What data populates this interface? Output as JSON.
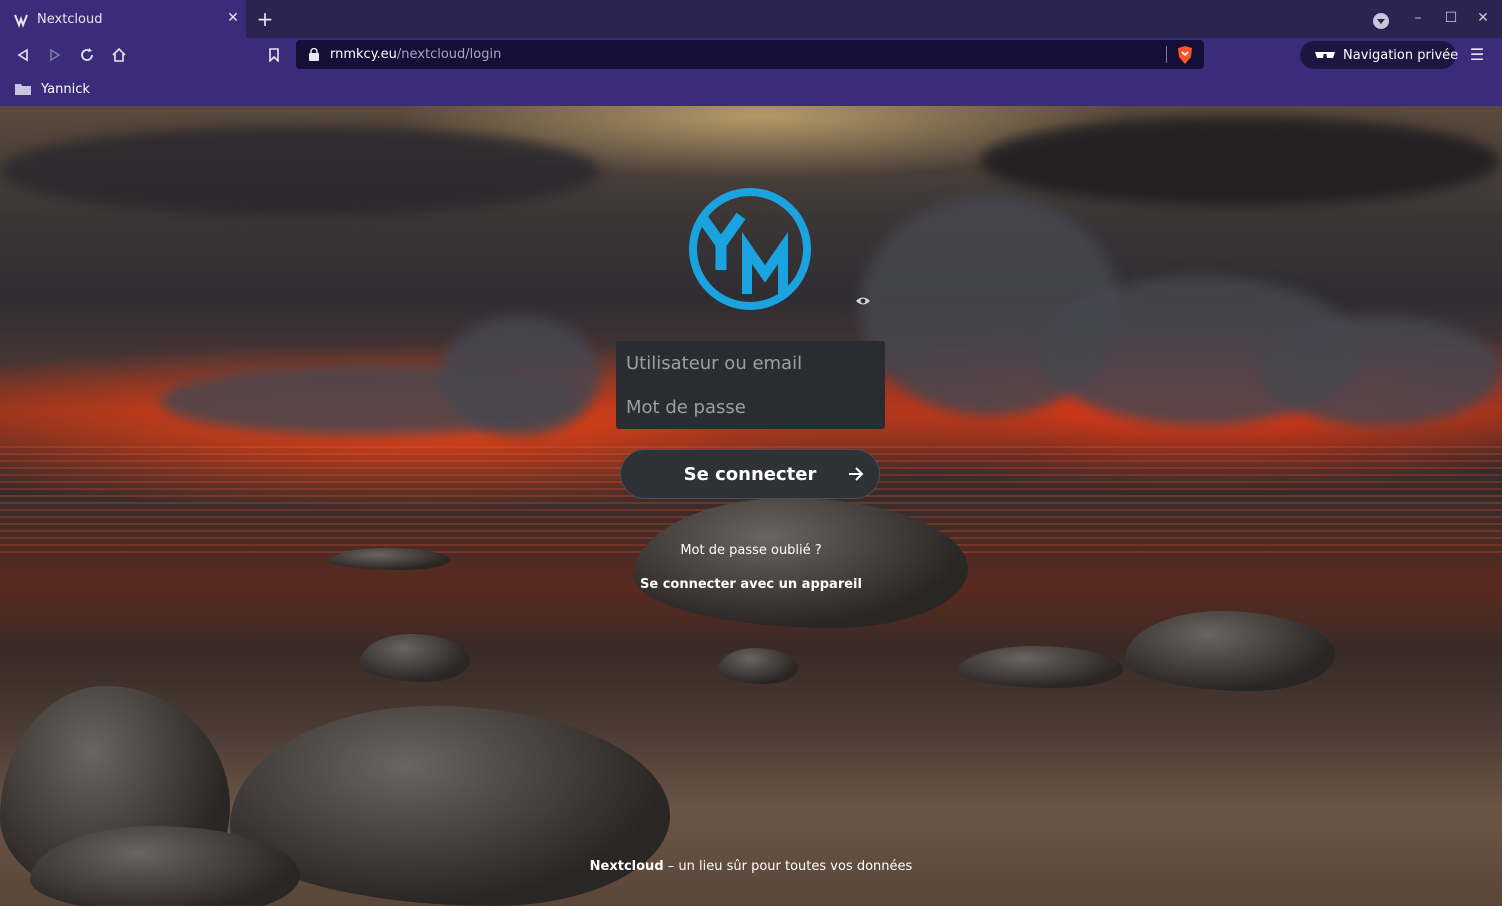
{
  "browser": {
    "tab": {
      "title": "Nextcloud"
    },
    "url": {
      "host": "rnmkcy.eu",
      "path": "/nextcloud/login"
    },
    "private_label": "Navigation privée",
    "bookmarks": [
      {
        "label": "Yannick"
      }
    ]
  },
  "login": {
    "user_placeholder": "Utilisateur ou email",
    "password_placeholder": "Mot de passe",
    "submit_label": "Se connecter",
    "forgot_password": "Mot de passe oublié ?",
    "device_login": "Se connecter avec un appareil"
  },
  "footer": {
    "brand": "Nextcloud",
    "tagline": " – un lieu sûr pour toutes vos données"
  },
  "colors": {
    "chrome": "#3a2c7a",
    "logo_accent": "#1ba3e0"
  }
}
